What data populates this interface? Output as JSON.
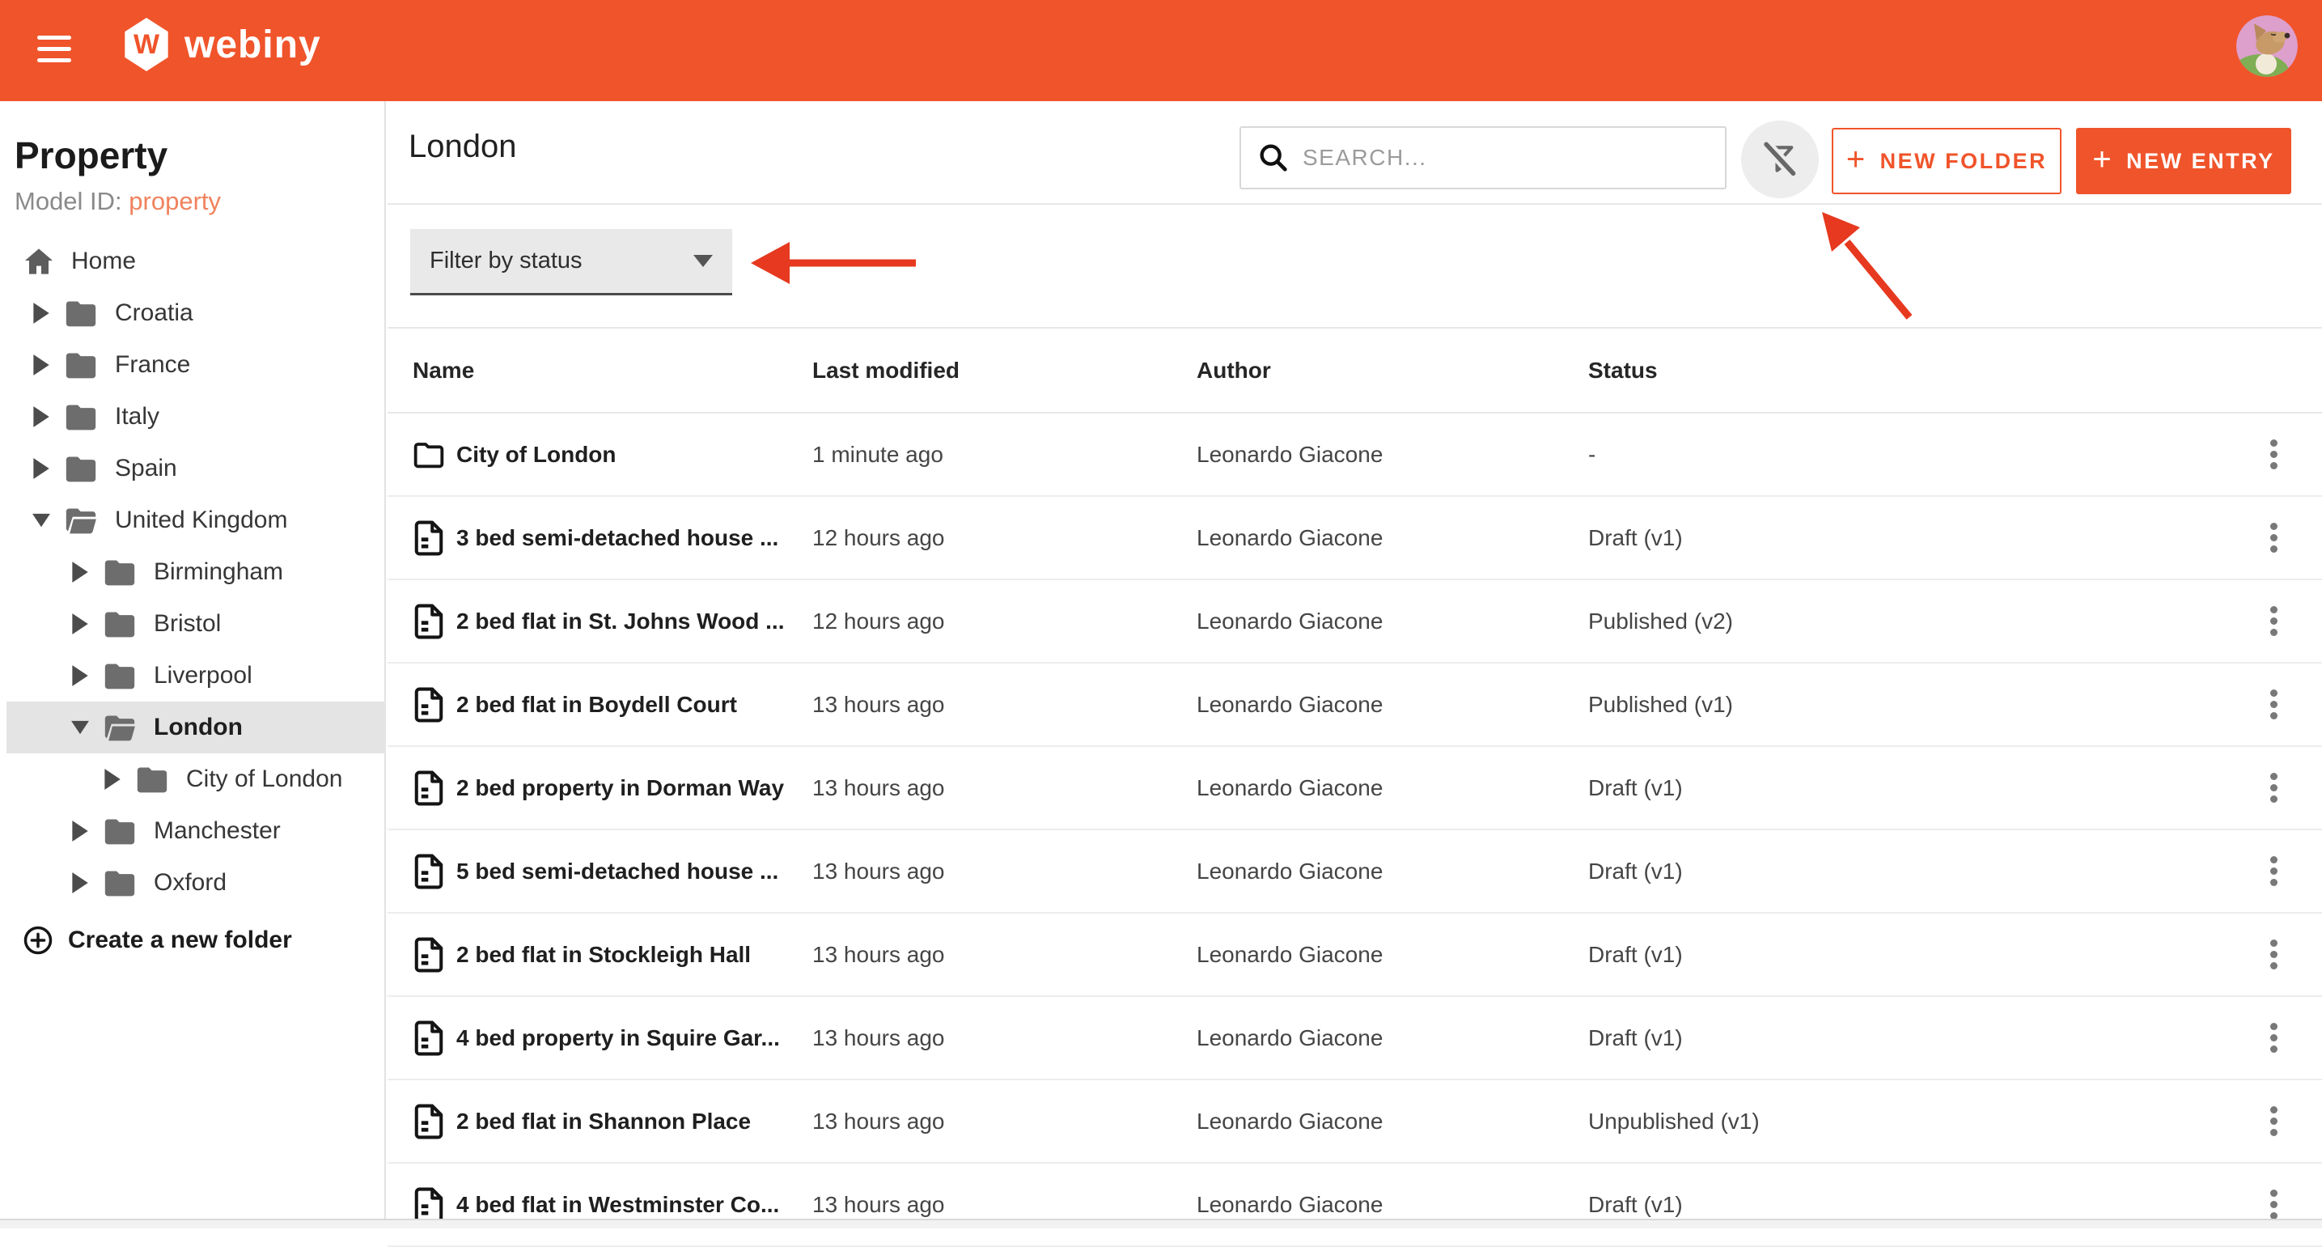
{
  "colors": {
    "accent": "#f0542b",
    "accent_light": "#f0825d",
    "annotation_arrow": "#e6391f"
  },
  "appbar": {
    "logo_text": "webiny"
  },
  "sidebar": {
    "title": "Property",
    "model_id_label": "Model ID:",
    "model_id_value": "property",
    "create_folder_label": "Create a new folder",
    "tree": [
      {
        "label": "Home"
      },
      {
        "label": "Croatia"
      },
      {
        "label": "France"
      },
      {
        "label": "Italy"
      },
      {
        "label": "Spain"
      },
      {
        "label": "United Kingdom"
      },
      {
        "label": "Birmingham"
      },
      {
        "label": "Bristol"
      },
      {
        "label": "Liverpool"
      },
      {
        "label": "London"
      },
      {
        "label": "City of London"
      },
      {
        "label": "Manchester"
      },
      {
        "label": "Oxford"
      }
    ]
  },
  "main": {
    "title": "London",
    "search_placeholder": "SEARCH...",
    "new_folder_label": "NEW FOLDER",
    "new_entry_label": "NEW ENTRY",
    "filter_label": "Filter by status",
    "table": {
      "headers": [
        "Name",
        "Last modified",
        "Author",
        "Status"
      ],
      "rows": [
        {
          "name": "City of London",
          "modified": "1 minute ago",
          "author": "Leonardo Giacone",
          "status": "-",
          "type": "folder"
        },
        {
          "name": "3 bed semi-detached house ...",
          "modified": "12 hours ago",
          "author": "Leonardo Giacone",
          "status": "Draft (v1)",
          "type": "document"
        },
        {
          "name": "2 bed flat in St. Johns Wood ...",
          "modified": "12 hours ago",
          "author": "Leonardo Giacone",
          "status": "Published (v2)",
          "type": "document"
        },
        {
          "name": "2 bed flat in Boydell Court",
          "modified": "13 hours ago",
          "author": "Leonardo Giacone",
          "status": "Published (v1)",
          "type": "document"
        },
        {
          "name": "2 bed property in Dorman Way",
          "modified": "13 hours ago",
          "author": "Leonardo Giacone",
          "status": "Draft (v1)",
          "type": "document"
        },
        {
          "name": "5 bed semi-detached house ...",
          "modified": "13 hours ago",
          "author": "Leonardo Giacone",
          "status": "Draft (v1)",
          "type": "document"
        },
        {
          "name": "2 bed flat in Stockleigh Hall",
          "modified": "13 hours ago",
          "author": "Leonardo Giacone",
          "status": "Draft (v1)",
          "type": "document"
        },
        {
          "name": "4 bed property in Squire Gar...",
          "modified": "13 hours ago",
          "author": "Leonardo Giacone",
          "status": "Draft (v1)",
          "type": "document"
        },
        {
          "name": "2 bed flat in Shannon Place",
          "modified": "13 hours ago",
          "author": "Leonardo Giacone",
          "status": "Unpublished (v1)",
          "type": "document"
        },
        {
          "name": "4 bed flat in Westminster Co...",
          "modified": "13 hours ago",
          "author": "Leonardo Giacone",
          "status": "Draft (v1)",
          "type": "document"
        }
      ]
    }
  }
}
